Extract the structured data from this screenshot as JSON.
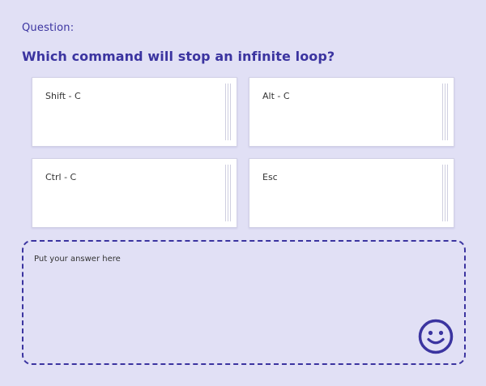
{
  "question": {
    "label": "Question:",
    "text": "Which command will stop an infinite loop?"
  },
  "options": [
    {
      "label": "Shift - C"
    },
    {
      "label": "Alt - C"
    },
    {
      "label": "Ctrl - C"
    },
    {
      "label": "Esc"
    }
  ],
  "answer_zone": {
    "placeholder": "Put your answer here"
  },
  "colors": {
    "accent": "#3b34a0",
    "background": "#e1e0f5",
    "card": "#ffffff"
  },
  "icons": {
    "feedback": "smiley-face-icon",
    "handle": "drag-handle-icon"
  }
}
